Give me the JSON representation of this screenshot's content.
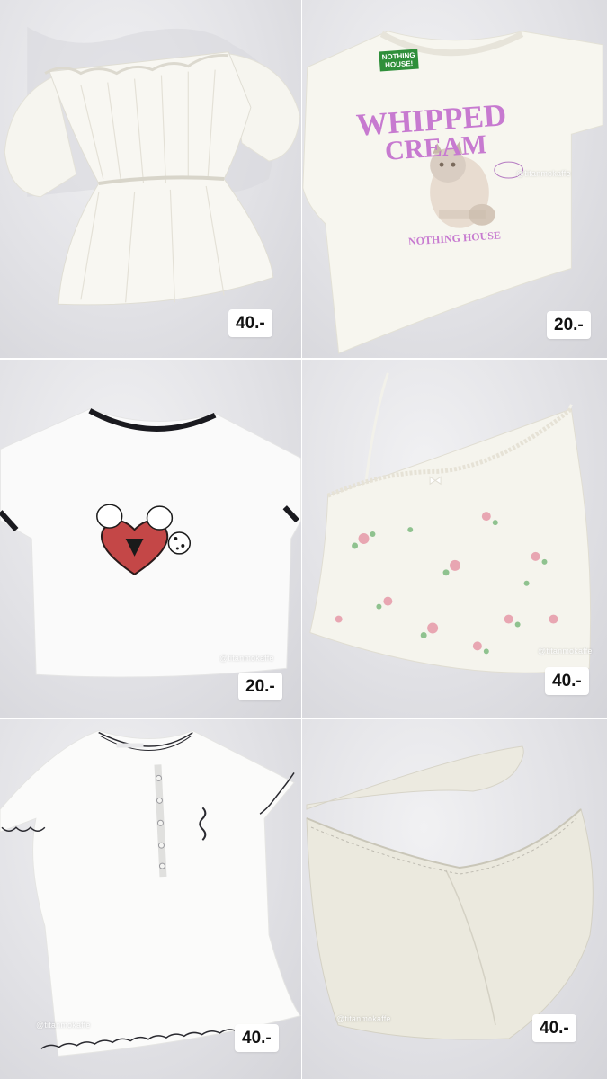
{
  "watermark": "@titanmokaffe",
  "items": [
    {
      "price": "40.-"
    },
    {
      "price": "20.-",
      "print_line1": "WHIPPED",
      "print_line2": "CREAM",
      "print_brand": "NOTHING HOUSE",
      "tag_text_1": "NOTHING",
      "tag_text_2": "HOUSE!"
    },
    {
      "price": "20.-"
    },
    {
      "price": "40.-"
    },
    {
      "price": "40.-"
    },
    {
      "price": "40.-"
    }
  ]
}
